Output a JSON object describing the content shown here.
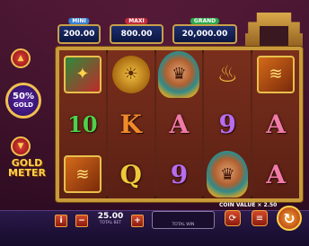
{
  "jackpots": {
    "mini": {
      "label": "MINI",
      "value": "200.00"
    },
    "maxi": {
      "label": "MAXI",
      "value": "800.00"
    },
    "grand": {
      "label": "GRAND",
      "value": "20,000.00"
    }
  },
  "gold_meter": {
    "percent": "50%",
    "label": "GOLD",
    "title_line1": "GOLD",
    "title_line2": "METER"
  },
  "reels": [
    [
      "bird",
      "10",
      "pipes"
    ],
    [
      "mask",
      "K",
      "Q"
    ],
    [
      "woman",
      "A",
      "9"
    ],
    [
      "lamp",
      "9",
      "woman"
    ],
    [
      "pipes",
      "A",
      "A"
    ]
  ],
  "symbol_glyphs": {
    "bird": "✦",
    "pipes": "≋",
    "mask": "☀",
    "woman": "♛",
    "lamp": "♨"
  },
  "coin_value": {
    "label": "COIN VALUE",
    "value": "2.50"
  },
  "bet": {
    "value": "25.00",
    "label": "TOTAL BET"
  },
  "win": {
    "label": "TOTAL WIN"
  },
  "controls": {
    "info": "i",
    "minus": "−",
    "plus": "+",
    "autoplay": "⟳",
    "bet_max": "≡",
    "spin": "↻",
    "up": "▲",
    "down": "▼"
  }
}
